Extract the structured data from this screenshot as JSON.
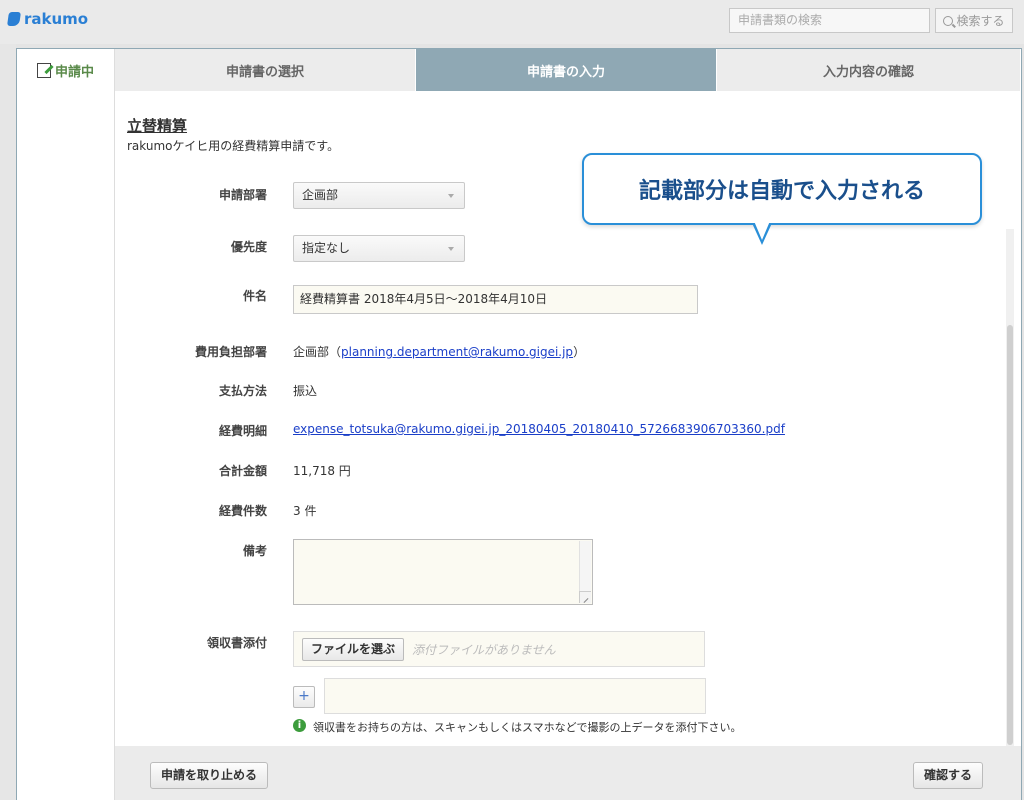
{
  "app": {
    "logo_text": "rakumo"
  },
  "search": {
    "placeholder": "申請書類の検索",
    "button_label": "検索する"
  },
  "sidebar": {
    "status_label": "申請中"
  },
  "steps": [
    {
      "label": "申請書の選択"
    },
    {
      "label": "申請書の入力"
    },
    {
      "label": "入力内容の確認"
    }
  ],
  "form": {
    "title": "立替精算",
    "description": "rakumoケイヒ用の経費精算申請です。",
    "fields": {
      "department": {
        "label": "申請部署",
        "value": "企画部"
      },
      "priority": {
        "label": "優先度",
        "value": "指定なし"
      },
      "subject": {
        "label": "件名",
        "value": "経費精算書 2018年4月5日～2018年4月10日"
      },
      "cost_dept": {
        "label": "費用負担部署",
        "value_prefix": "企画部（",
        "email": "planning.department@rakumo.gigei.jp",
        "value_suffix": "）"
      },
      "payment": {
        "label": "支払方法",
        "value": "振込"
      },
      "details": {
        "label": "経費明細",
        "file_link": "expense_totsuka@rakumo.gigei.jp_20180405_20180410_5726683906703360.pdf"
      },
      "total": {
        "label": "合計金額",
        "value": "11,718 円"
      },
      "count": {
        "label": "経費件数",
        "value": "3 件"
      },
      "remarks": {
        "label": "備考",
        "value": ""
      },
      "receipt": {
        "label": "領収書添付",
        "choose_button": "ファイルを選ぶ",
        "placeholder": "添付ファイルがありません",
        "add_button": "+",
        "note": "領収書をお持ちの方は、スキャンもしくはスマホなどで撮影の上データを添付下さい。"
      }
    }
  },
  "footer": {
    "cancel_label": "申請を取り止める",
    "confirm_label": "確認する"
  },
  "callout": {
    "text": "記載部分は自動で入力される"
  },
  "colors": {
    "accent": "#2a7fd4",
    "step_active": "#8fa8b4",
    "link": "#1a3ec8",
    "status_green": "#5a8a4a",
    "callout_border": "#2a8fd8"
  }
}
